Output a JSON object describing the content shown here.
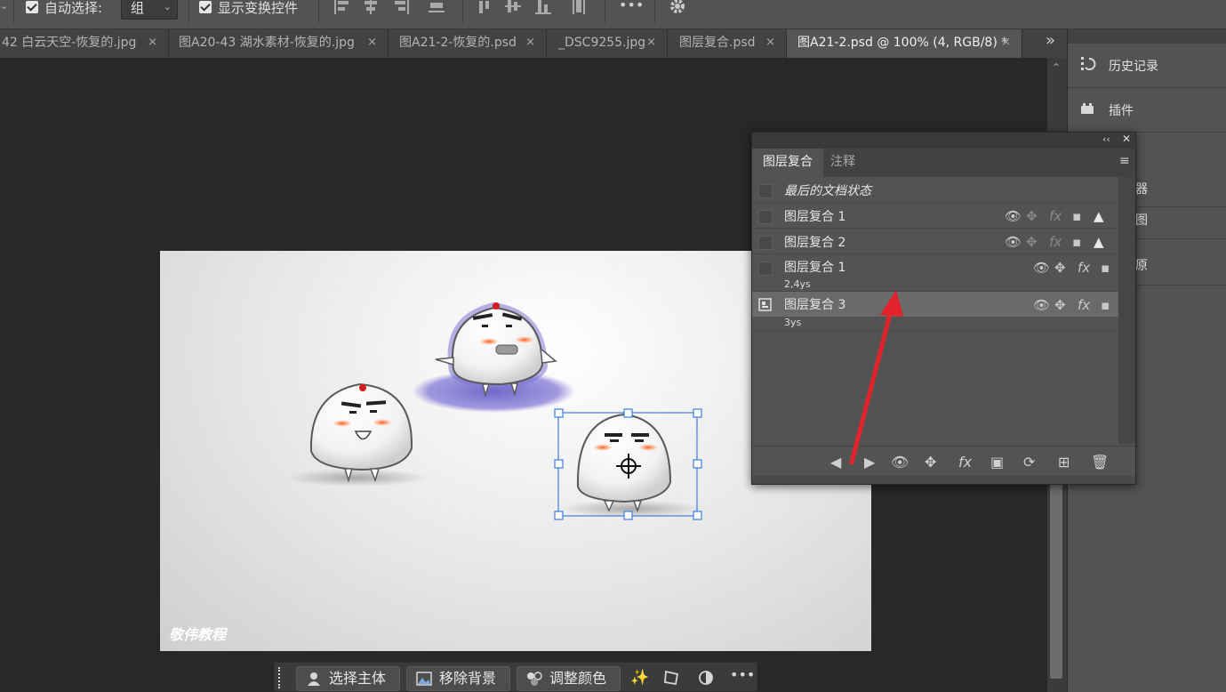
{
  "options_bar": {
    "auto_select_label": "自动选择:",
    "auto_select_value": "组",
    "show_transform_label": "显示变换控件",
    "more_label": "•••"
  },
  "tabs": [
    {
      "label": "42 白云天空-恢复的.jpg",
      "active": false
    },
    {
      "label": "图A20-43 湖水素材-恢复的.jpg",
      "active": false
    },
    {
      "label": "图A21-2-恢复的.psd",
      "active": false
    },
    {
      "label": "_DSC9255.jpg",
      "active": false
    },
    {
      "label": "图层复合.psd",
      "active": false
    },
    {
      "label": "图A21-2.psd @ 100% (4, RGB/8) *",
      "active": true
    }
  ],
  "tab_overflow": "»",
  "tab_close": "×",
  "dock": {
    "items": [
      {
        "label": "历史记录",
        "icon": "history-icon"
      },
      {
        "label": "插件",
        "icon": "plugins-icon"
      },
      {
        "label": "器",
        "icon": ""
      },
      {
        "label": "图",
        "icon": ""
      },
      {
        "label": "原",
        "icon": ""
      }
    ]
  },
  "panel": {
    "tabs": [
      {
        "label": "图层复合",
        "active": true
      },
      {
        "label": "注释",
        "active": false
      }
    ],
    "collapse": "‹‹",
    "close": "✕",
    "menu": "≡",
    "rows": [
      {
        "name": "最后的文档状态",
        "sub": "",
        "italic": true,
        "selected": false,
        "icons": false,
        "warn": false
      },
      {
        "name": "图层复合 1",
        "sub": "",
        "italic": false,
        "selected": false,
        "icons": true,
        "warn": true
      },
      {
        "name": "图层复合 2",
        "sub": "",
        "italic": false,
        "selected": false,
        "icons": true,
        "warn": true
      },
      {
        "name": "图层复合 1",
        "sub": "2,4ys",
        "italic": false,
        "selected": false,
        "icons": true,
        "warn": false
      },
      {
        "name": "图层复合 3",
        "sub": "3ys",
        "italic": false,
        "selected": true,
        "icons": true,
        "warn": false
      }
    ],
    "fx_label": "fx",
    "footer_fx": "fx"
  },
  "canvas": {
    "watermark": "敬伟教程"
  },
  "taskbar": {
    "select_subject": "选择主体",
    "remove_bg": "移除背景",
    "adjust_color": "调整颜色",
    "more": "•••"
  },
  "colors": {
    "accent_arrow": "#e3232b",
    "selection_handle": "#3b7fe0"
  }
}
